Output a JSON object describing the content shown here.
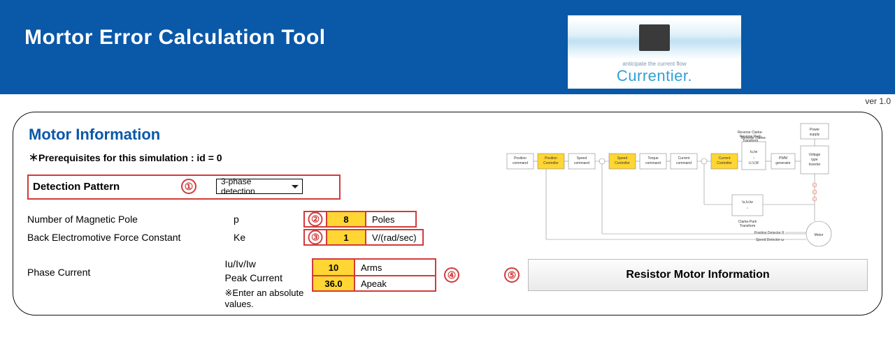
{
  "header": {
    "title": "Mortor Error Calculation Tool",
    "brand_sub": "anticipate the current flow",
    "brand_name": "Currentier.",
    "version": "ver 1.0"
  },
  "section": {
    "title": "Motor Information",
    "prereq": "＊Prerequisites for this simulation : id = 0",
    "detection": {
      "label": "Detection Pattern",
      "annot": "①",
      "options": [
        "3-phase detection"
      ],
      "selected": "3-phase detection"
    },
    "params": [
      {
        "label": "Number of Magnetic Pole",
        "symbol": "p",
        "annot": "②",
        "value": "8",
        "unit": "Poles"
      },
      {
        "label": "Back Electromotive Force Constant",
        "symbol": "Ke",
        "annot": "③",
        "value": "1",
        "unit": "V/(rad/sec)"
      }
    ],
    "phase_current": {
      "label": "Phase Current",
      "symbol1": "Iu/Iv/Iw",
      "symbol2": "Peak Current",
      "value1": "10",
      "unit1": "Arms",
      "value2": "36.0",
      "unit2": "Apeak",
      "annot": "④",
      "footnote": "※Enter an absolute values."
    },
    "button": {
      "annot": "⑤",
      "label": "Resistor Motor Information"
    }
  },
  "diagram_blocks": [
    "Position command",
    "Position Controller",
    "Speed command",
    "Speed Controller",
    "Torque command",
    "Current command",
    "Current Controller",
    "Iu,Iw",
    "U,V,W",
    "PWM generator",
    "Voltage type Inverter",
    "Power supply",
    "Clarke-Park Transform",
    "Reverse Clarke-Reverse Park Transform",
    "Iu,Iv,Iw",
    "Position Detector θ",
    "Speed Detector ω",
    "Motor"
  ]
}
